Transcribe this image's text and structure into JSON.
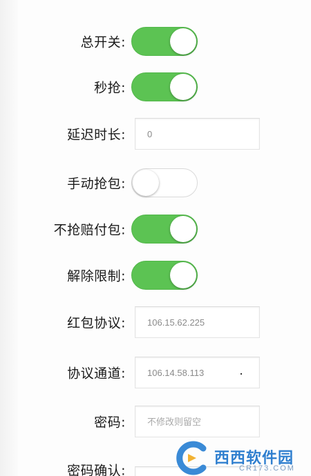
{
  "settings": {
    "master_switch": {
      "label": "总开关:",
      "state": true
    },
    "instant_grab": {
      "label": "秒抢:",
      "state": true
    },
    "delay": {
      "label": "延迟时长:",
      "value": "0"
    },
    "manual_grab": {
      "label": "手动抢包:",
      "state": false
    },
    "no_compensation": {
      "label": "不抢赔付包:",
      "state": true
    },
    "remove_limits": {
      "label": "解除限制:",
      "state": true
    },
    "redpacket_protocol": {
      "label": "红包协议:",
      "value": "106.15.62.225"
    },
    "protocol_channel": {
      "label": "协议通道:",
      "value": "106.14.58.113"
    },
    "password": {
      "label": "密码:",
      "placeholder": "不修改则留空"
    },
    "password_confirm": {
      "label": "密码确认:",
      "placeholder": ""
    }
  },
  "colors": {
    "toggle_on": "#5cc353",
    "toggle_off": "#ffffff",
    "text": "#1a1a1a",
    "field_text": "#8a8a8a"
  },
  "watermark": {
    "brand": "西西软件园",
    "domain": "CR173.COM",
    "icon": "cr-logo-icon"
  }
}
